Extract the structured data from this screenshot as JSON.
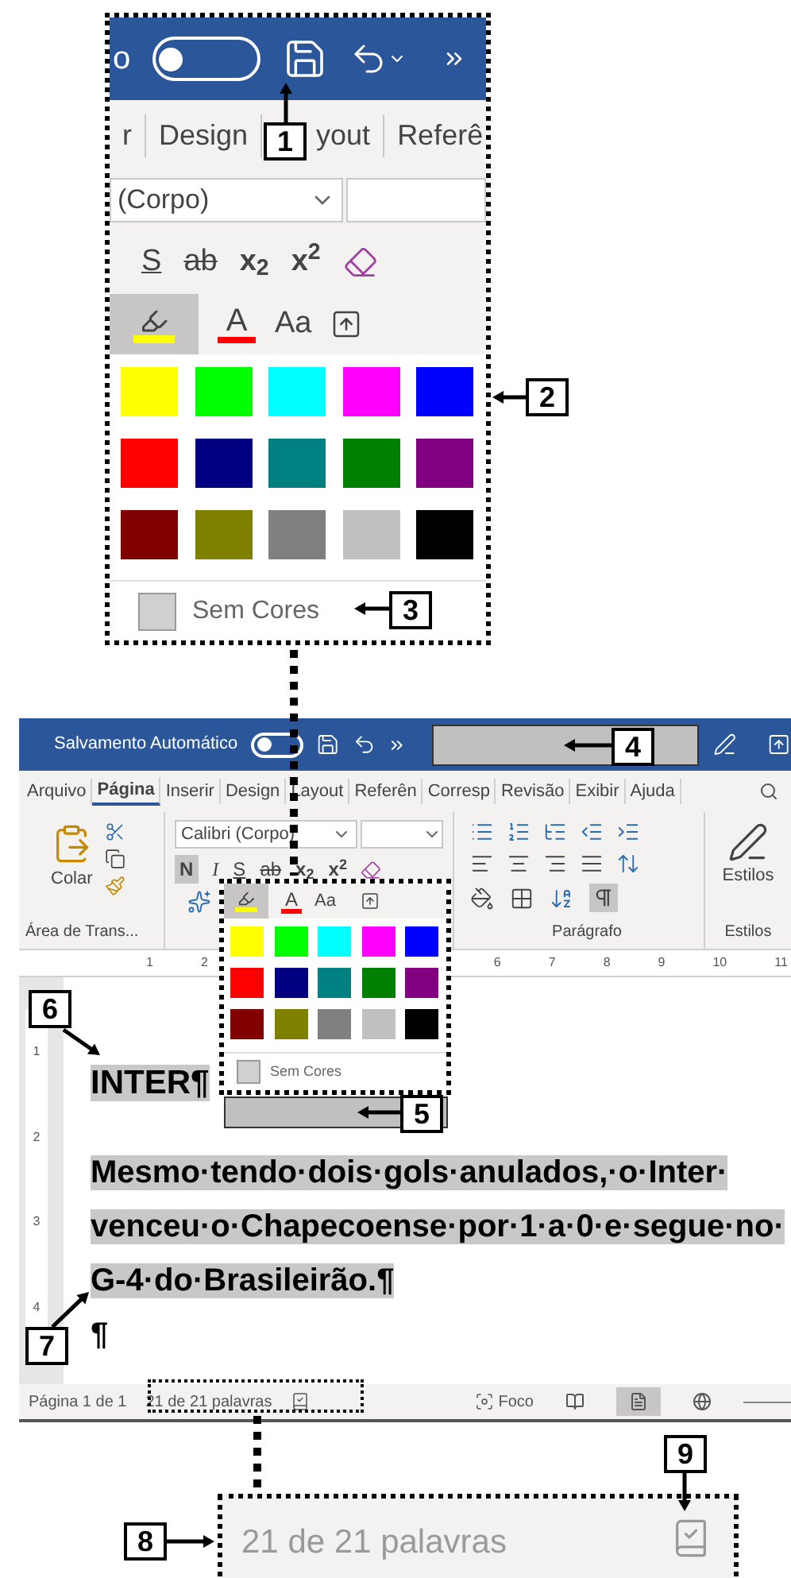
{
  "top_inset": {
    "title_fragment": "o",
    "autosave_on": false,
    "tabs": [
      {
        "label": "r",
        "selected": false
      },
      {
        "label": "Design",
        "selected": false
      },
      {
        "label": "yout",
        "selected": false
      },
      {
        "label": "Referê",
        "selected": false
      }
    ],
    "font_name": "(Corpo)",
    "font_color_label": "A",
    "format_buttons": [
      "S",
      "ab",
      "x$_{2}$",
      "x$^{2}$"
    ],
    "case_label": "Aa",
    "highlight_on": true,
    "palette": [
      {
        "color": "#ffff00"
      },
      {
        "color": "#00ff00"
      },
      {
        "color": "#00ffff"
      },
      {
        "color": "#ff00ff"
      },
      {
        "color": "#0000ff"
      },
      {
        "color": "#ff0000"
      },
      {
        "color": "#000080"
      },
      {
        "color": "#008080"
      },
      {
        "color": "#008000"
      },
      {
        "color": "#800080"
      },
      {
        "color": "#800000"
      },
      {
        "color": "#808000"
      },
      {
        "color": "#808080"
      },
      {
        "color": "#c0c0c0"
      },
      {
        "color": "#000000"
      }
    ],
    "no_color_label": "Sem Cores"
  },
  "window": {
    "autosave_label": "Salvamento Automático",
    "autosave_on": false
  },
  "tabs": [
    {
      "label": "Arquivo",
      "selected": false
    },
    {
      "label": "Página",
      "selected": true
    },
    {
      "label": "Inserir",
      "selected": false
    },
    {
      "label": "Design",
      "selected": false
    },
    {
      "label": "Layout",
      "selected": false
    },
    {
      "label": "Referên",
      "selected": false
    },
    {
      "label": "Corresp",
      "selected": false
    },
    {
      "label": "Revisão",
      "selected": false
    },
    {
      "label": "Exibir",
      "selected": false
    },
    {
      "label": "Ajuda",
      "selected": false
    }
  ],
  "clipboard": {
    "paste_label": "Colar",
    "group_label": "Área de Trans..."
  },
  "font": {
    "name": "Calibri (Corpo)",
    "bold_label": "N",
    "italic_label": "I",
    "underline_label": "S",
    "strike_label": "ab",
    "sub_label": "x$_{2}$",
    "sup_label": "x$^{2}$",
    "bold_on": true
  },
  "paragraph": {
    "group_label": "Parágrafo",
    "show_marks_on": true
  },
  "styles": {
    "button_label": "Estilos",
    "group_label": "Estilos"
  },
  "ruler": {
    "numbers": [
      "1",
      "2",
      "6",
      "7",
      "8",
      "9",
      "10",
      "11"
    ],
    "vertical_numbers": [
      "1",
      "2",
      "3",
      "4"
    ]
  },
  "popup": {
    "case_label": "Aa",
    "font_color_label": "A",
    "highlight_on": true,
    "palette": [
      {
        "color": "#ffff00"
      },
      {
        "color": "#00ff00"
      },
      {
        "color": "#00ffff"
      },
      {
        "color": "#ff00ff"
      },
      {
        "color": "#0000ff"
      },
      {
        "color": "#ff0000"
      },
      {
        "color": "#000080"
      },
      {
        "color": "#008080"
      },
      {
        "color": "#008000"
      },
      {
        "color": "#800080"
      },
      {
        "color": "#800000"
      },
      {
        "color": "#808000"
      },
      {
        "color": "#808080"
      },
      {
        "color": "#c0c0c0"
      },
      {
        "color": "#000000"
      }
    ],
    "no_color_label": "Sem Cores"
  },
  "document": {
    "paragraphs": [
      {
        "kind": "heading",
        "text": "INTER¶",
        "selected": true
      },
      {
        "kind": "body",
        "text": "Mesmo·tendo·dois·gols·anulados,·o·Inter·venceu·o·Chapecoense·por·1·a·0·e·segue·no·G-4·do·Brasileirão.¶",
        "selected": true
      },
      {
        "kind": "body",
        "text": "¶",
        "selected": false
      }
    ]
  },
  "status_bar": {
    "page": "Página 1 de 1",
    "words": "21 de 21 palavras",
    "focus": "Foco",
    "views": [
      {
        "selected": false
      },
      {
        "selected": true
      },
      {
        "selected": false
      }
    ]
  },
  "bottom_inset": {
    "words": "21 de 21 palavras"
  },
  "callouts": [
    {
      "number": "1"
    },
    {
      "number": "2"
    },
    {
      "number": "3"
    },
    {
      "number": "4"
    },
    {
      "number": "5"
    },
    {
      "number": "6"
    },
    {
      "number": "7"
    },
    {
      "number": "8"
    },
    {
      "number": "9"
    }
  ]
}
